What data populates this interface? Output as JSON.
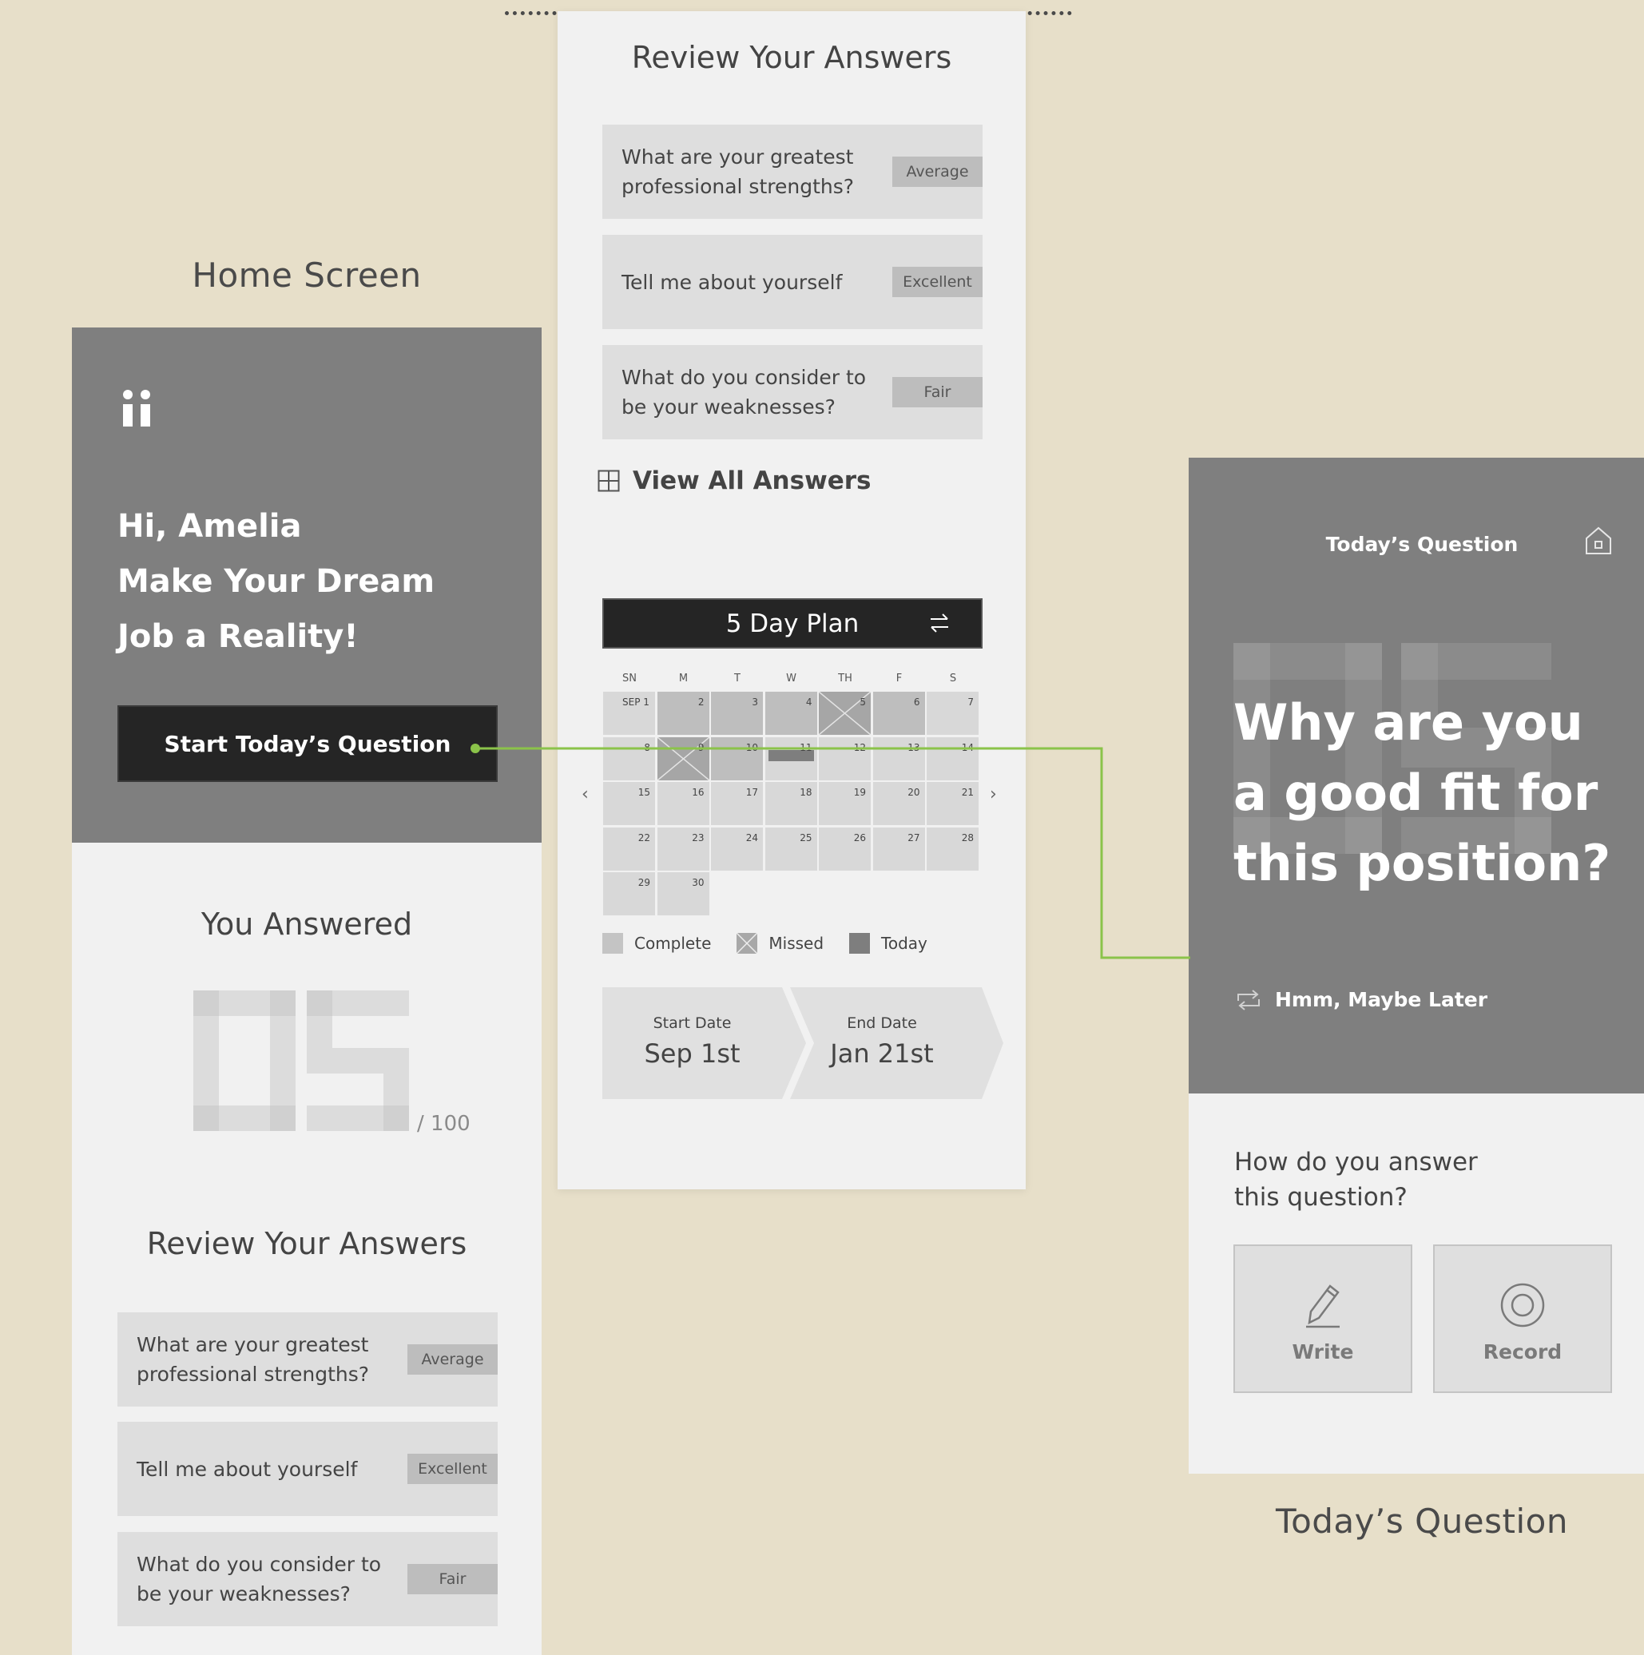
{
  "labels": {
    "home_screen": "Home Screen",
    "todays_question": "Today’s Question"
  },
  "home": {
    "greeting_lines": [
      "Hi, Amelia",
      "Make Your Dream",
      "Job a Reality!"
    ],
    "start_button": "Start Today’s Question",
    "you_answered": "You Answered",
    "answered_count": "05",
    "answered_total": "/ 100",
    "review_title": "Review Your Answers",
    "answers": [
      {
        "question": "What are your greatest professional strengths?",
        "rating": "Average"
      },
      {
        "question": "Tell me about yourself",
        "rating": "Excellent"
      },
      {
        "question": "What do you consider to be your weaknesses?",
        "rating": "Fair"
      }
    ]
  },
  "review_panel": {
    "title": "Review Your Answers",
    "answers": [
      {
        "question": "What are your greatest professional strengths?",
        "rating": "Average"
      },
      {
        "question": "Tell me about yourself",
        "rating": "Excellent"
      },
      {
        "question": "What do you consider to be your weaknesses?",
        "rating": "Fair"
      }
    ],
    "view_all": "View All Answers",
    "plan_title": "5 Day Plan",
    "weekdays": [
      "SN",
      "M",
      "T",
      "W",
      "TH",
      "F",
      "S"
    ],
    "calendar": [
      {
        "day": "SEP 1",
        "state": "empty"
      },
      {
        "day": "2",
        "state": "complete"
      },
      {
        "day": "3",
        "state": "complete"
      },
      {
        "day": "4",
        "state": "complete"
      },
      {
        "day": "5",
        "state": "missed"
      },
      {
        "day": "6",
        "state": "complete"
      },
      {
        "day": "7",
        "state": "empty"
      },
      {
        "day": "8",
        "state": "empty"
      },
      {
        "day": "9",
        "state": "missed"
      },
      {
        "day": "10",
        "state": "complete"
      },
      {
        "day": "11",
        "state": "today"
      },
      {
        "day": "12",
        "state": "empty"
      },
      {
        "day": "13",
        "state": "empty"
      },
      {
        "day": "14",
        "state": "empty"
      },
      {
        "day": "15",
        "state": "empty"
      },
      {
        "day": "16",
        "state": "empty"
      },
      {
        "day": "17",
        "state": "empty"
      },
      {
        "day": "18",
        "state": "empty"
      },
      {
        "day": "19",
        "state": "empty"
      },
      {
        "day": "20",
        "state": "empty"
      },
      {
        "day": "21",
        "state": "empty"
      },
      {
        "day": "22",
        "state": "empty"
      },
      {
        "day": "23",
        "state": "empty"
      },
      {
        "day": "24",
        "state": "empty"
      },
      {
        "day": "25",
        "state": "empty"
      },
      {
        "day": "26",
        "state": "empty"
      },
      {
        "day": "27",
        "state": "empty"
      },
      {
        "day": "28",
        "state": "empty"
      },
      {
        "day": "29",
        "state": "empty"
      },
      {
        "day": "30",
        "state": "empty"
      }
    ],
    "legend": {
      "complete": "Complete",
      "missed": "Missed",
      "today": "Today"
    },
    "start_date_label": "Start Date",
    "start_date": "Sep 1st",
    "end_date_label": "End Date",
    "end_date": "Jan 21st"
  },
  "question_screen": {
    "header": "Today’s Question",
    "question_lines": [
      "Why are you",
      "a good fit for",
      "this position?"
    ],
    "maybe_later": "Hmm, Maybe Later",
    "how_prompt": "How do you answer this question?",
    "options": [
      {
        "label": "Write",
        "icon": "pencil-icon"
      },
      {
        "label": "Record",
        "icon": "record-icon"
      }
    ]
  },
  "colors": {
    "background": "#e7dfc9",
    "hero_gray": "#7f7f7f",
    "panel": "#f1f1f1",
    "card": "#dedede",
    "dark_button": "#252525",
    "connector": "#8bc34a"
  }
}
